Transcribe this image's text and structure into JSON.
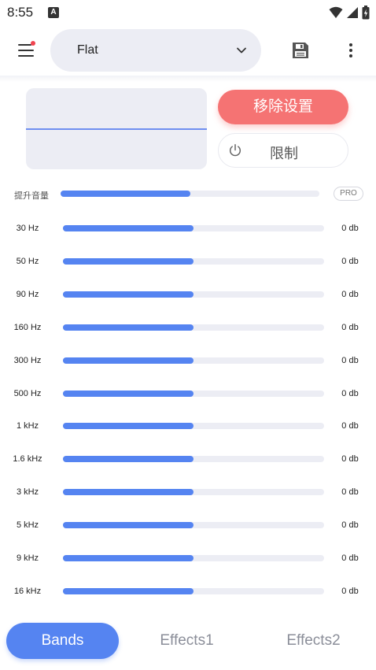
{
  "status_bar": {
    "time": "8:55",
    "notification_letter": "A"
  },
  "header": {
    "preset": "Flat",
    "icons": {
      "menu": "menu-icon",
      "dropdown": "chevron-down-icon",
      "save": "save-icon",
      "more": "more-vertical-icon"
    },
    "colors": {
      "notification_dot": "#f0444f"
    }
  },
  "controls": {
    "remove_settings": "移除设置",
    "limit": "限制",
    "limit_icon": "power-icon",
    "colors": {
      "remove_button": "#f57373",
      "visualizer_line": "#6f8ff0"
    }
  },
  "boost": {
    "label": "提升音量",
    "level": 0.5,
    "badge": "PRO"
  },
  "bands": [
    {
      "freq": "30 Hz",
      "value": "0 db",
      "level": 0.5
    },
    {
      "freq": "50 Hz",
      "value": "0 db",
      "level": 0.5
    },
    {
      "freq": "90 Hz",
      "value": "0 db",
      "level": 0.5
    },
    {
      "freq": "160 Hz",
      "value": "0 db",
      "level": 0.5
    },
    {
      "freq": "300 Hz",
      "value": "0 db",
      "level": 0.5
    },
    {
      "freq": "500 Hz",
      "value": "0 db",
      "level": 0.5
    },
    {
      "freq": "1 kHz",
      "value": "0 db",
      "level": 0.5
    },
    {
      "freq": "1.6 kHz",
      "value": "0 db",
      "level": 0.5
    },
    {
      "freq": "3 kHz",
      "value": "0 db",
      "level": 0.5
    },
    {
      "freq": "5 kHz",
      "value": "0 db",
      "level": 0.5
    },
    {
      "freq": "9 kHz",
      "value": "0 db",
      "level": 0.5
    },
    {
      "freq": "16 kHz",
      "value": "0 db",
      "level": 0.5
    }
  ],
  "tabs": [
    {
      "label": "Bands",
      "active": true
    },
    {
      "label": "Effects1",
      "active": false
    },
    {
      "label": "Effects2",
      "active": false
    }
  ],
  "accent_color": "#5584f1",
  "track_color": "#ecedf4"
}
